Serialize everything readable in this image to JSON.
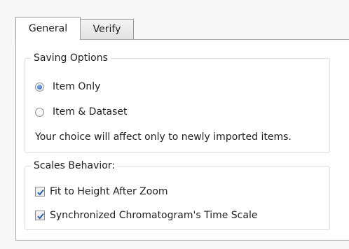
{
  "tabs": [
    {
      "label": "General",
      "selected": true
    },
    {
      "label": "Verify",
      "selected": false
    }
  ],
  "saving_options": {
    "legend": "Saving Options",
    "radios": [
      {
        "label": "Item Only",
        "checked": true
      },
      {
        "label": "Item & Dataset",
        "checked": false
      }
    ],
    "note": "Your choice will affect only to newly imported  items."
  },
  "scales_behavior": {
    "legend": "Scales Behavior:",
    "checkboxes": [
      {
        "label": "Fit to Height After Zoom",
        "checked": true
      },
      {
        "label": "Synchronized Chromatogram's Time Scale",
        "checked": true
      }
    ]
  },
  "colors": {
    "radio_dot": "#1f57b8",
    "check_mark": "#2c62b0",
    "panel_border": "#a9a9a9"
  }
}
